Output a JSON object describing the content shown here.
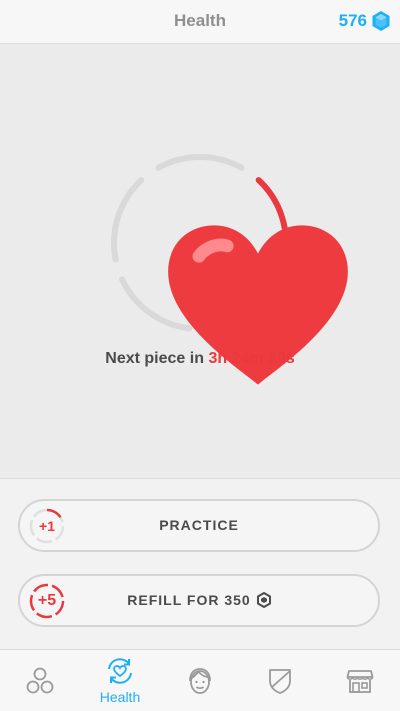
{
  "header": {
    "title": "Health",
    "gem_count": "576",
    "gem_icon": "blue-gem-icon"
  },
  "health": {
    "next_piece_label": "Next piece in",
    "next_piece_time": "3h 24m 20s",
    "heart_icon": "heart-icon",
    "filled_segments": 2,
    "total_segments": 5
  },
  "actions": {
    "practice": {
      "badge": "+1",
      "label": "PRACTICE"
    },
    "refill": {
      "badge": "+5",
      "label": "REFILL FOR 350",
      "icon": "lingot-icon"
    }
  },
  "nav": {
    "items": [
      {
        "name": "learn",
        "icon": "circles-icon",
        "label": ""
      },
      {
        "name": "health",
        "icon": "heart-refresh-icon",
        "label": "Health",
        "active": true
      },
      {
        "name": "profile",
        "icon": "face-icon",
        "label": ""
      },
      {
        "name": "leagues",
        "icon": "shield-icon",
        "label": ""
      },
      {
        "name": "shop",
        "icon": "store-icon",
        "label": ""
      }
    ]
  },
  "colors": {
    "accent": "#1cb0f6",
    "heart_red": "#e9393f",
    "ring_gray": "#d9d9d9",
    "text_dark": "#4b4b4b",
    "header_text": "#8f8f8f"
  }
}
